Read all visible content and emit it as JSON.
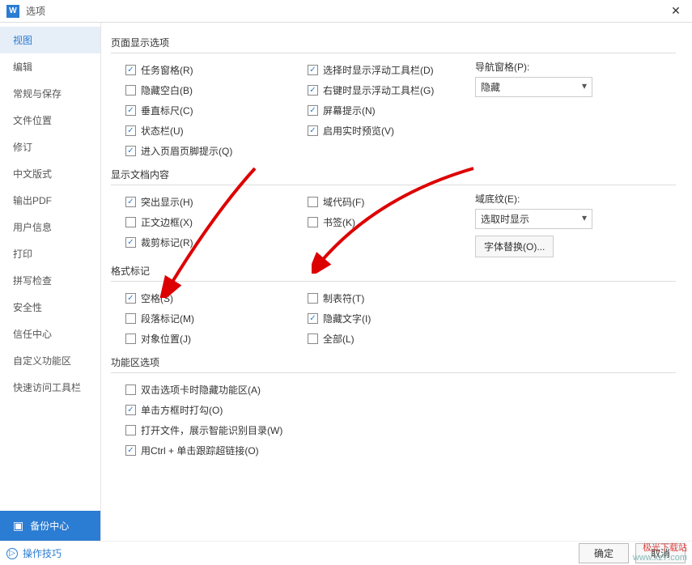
{
  "window": {
    "title": "选项",
    "appIconLetter": "W"
  },
  "sidebar": {
    "items": [
      "视图",
      "编辑",
      "常规与保存",
      "文件位置",
      "修订",
      "中文版式",
      "输出PDF",
      "用户信息",
      "打印",
      "拼写检查",
      "安全性",
      "信任中心",
      "自定义功能区",
      "快速访问工具栏"
    ],
    "backup": "备份中心"
  },
  "sections": {
    "pageDisplay": {
      "title": "页面显示选项",
      "col1": [
        {
          "label": "任务窗格(R)",
          "checked": true
        },
        {
          "label": "隐藏空白(B)",
          "checked": false
        },
        {
          "label": "垂直标尺(C)",
          "checked": true
        },
        {
          "label": "状态栏(U)",
          "checked": true
        },
        {
          "label": "进入页眉页脚提示(Q)",
          "checked": true
        }
      ],
      "col2": [
        {
          "label": "选择时显示浮动工具栏(D)",
          "checked": true
        },
        {
          "label": "右键时显示浮动工具栏(G)",
          "checked": true
        },
        {
          "label": "屏幕提示(N)",
          "checked": true
        },
        {
          "label": "启用实时预览(V)",
          "checked": true
        }
      ],
      "navPane": {
        "label": "导航窗格(P):",
        "value": "隐藏"
      }
    },
    "docContent": {
      "title": "显示文档内容",
      "col1": [
        {
          "label": "突出显示(H)",
          "checked": true
        },
        {
          "label": "正文边框(X)",
          "checked": false
        },
        {
          "label": "裁剪标记(R)",
          "checked": true
        }
      ],
      "col2": [
        {
          "label": "域代码(F)",
          "checked": false
        },
        {
          "label": "书签(K)",
          "checked": false
        }
      ],
      "shading": {
        "label": "域底纹(E):",
        "value": "选取时显示"
      },
      "fontReplace": "字体替换(O)..."
    },
    "formatMarks": {
      "title": "格式标记",
      "col1": [
        {
          "label": "空格(S)",
          "checked": true
        },
        {
          "label": "段落标记(M)",
          "checked": false
        },
        {
          "label": "对象位置(J)",
          "checked": false
        }
      ],
      "col2": [
        {
          "label": "制表符(T)",
          "checked": false
        },
        {
          "label": "隐藏文字(I)",
          "checked": true
        },
        {
          "label": "全部(L)",
          "checked": false
        }
      ]
    },
    "ribbon": {
      "title": "功能区选项",
      "items": [
        {
          "label": "双击选项卡时隐藏功能区(A)",
          "checked": false
        },
        {
          "label": "单击方框时打勾(O)",
          "checked": true
        },
        {
          "label": "打开文件，展示智能识别目录(W)",
          "checked": false
        },
        {
          "label": "用Ctrl + 单击跟踪超链接(O)",
          "checked": true
        }
      ]
    }
  },
  "footer": {
    "tips": "操作技巧",
    "ok": "确定",
    "cancel": "取消"
  },
  "watermark": {
    "line1": "极光下载站",
    "line2": "www.xz7.com"
  }
}
